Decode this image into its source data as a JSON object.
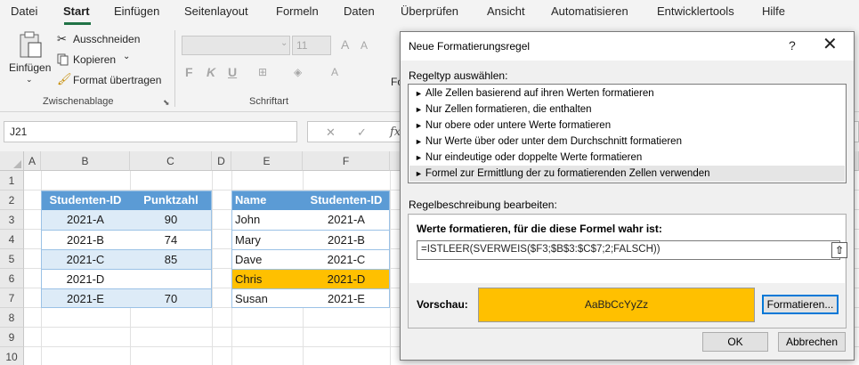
{
  "menu": {
    "items": [
      "Datei",
      "Start",
      "Einfügen",
      "Seitenlayout",
      "Formeln",
      "Daten",
      "Überprüfen",
      "Ansicht",
      "Automatisieren",
      "Entwicklertools",
      "Hilfe"
    ],
    "active": "Start"
  },
  "ribbon": {
    "clipboard": {
      "paste": "Einfügen",
      "cut": "Ausschneiden",
      "copy": "Kopieren",
      "format_painter": "Format übertragen",
      "group_label": "Zwischenablage"
    },
    "font": {
      "size": "11",
      "bold": "F",
      "italic": "K",
      "underline": "U",
      "group_label": "Schriftart"
    },
    "truncated_group": "Fo"
  },
  "formula_bar": {
    "name_box": "J21",
    "fx": "fx"
  },
  "grid": {
    "columns": [
      "A",
      "B",
      "C",
      "D",
      "E",
      "F"
    ],
    "rows": [
      "1",
      "2",
      "3",
      "4",
      "5",
      "6",
      "7",
      "8",
      "9",
      "10"
    ],
    "table1": {
      "headers": [
        "Studenten-ID",
        "Punktzahl"
      ],
      "rows": [
        [
          "2021-A",
          "90"
        ],
        [
          "2021-B",
          "74"
        ],
        [
          "2021-C",
          "85"
        ],
        [
          "2021-D",
          ""
        ],
        [
          "2021-E",
          "70"
        ]
      ]
    },
    "table2": {
      "headers": [
        "Name",
        "Studenten-ID"
      ],
      "rows": [
        [
          "John",
          "2021-A"
        ],
        [
          "Mary",
          "2021-B"
        ],
        [
          "Dave",
          "2021-C"
        ],
        [
          "Chris",
          "2021-D"
        ],
        [
          "Susan",
          "2021-E"
        ]
      ],
      "highlighted_row": 3,
      "highlight_color": "#ffc000"
    }
  },
  "dialog": {
    "title": "Neue Formatierungsregel",
    "help": "?",
    "close": "✕",
    "rule_type_label": "Regeltyp auswählen:",
    "rule_types": [
      "Alle Zellen basierend auf ihren Werten formatieren",
      "Nur Zellen formatieren, die enthalten",
      "Nur obere oder untere Werte formatieren",
      "Nur Werte über oder unter dem Durchschnitt formatieren",
      "Nur eindeutige oder doppelte Werte formatieren",
      "Formel zur Ermittlung der zu formatierenden Zellen verwenden"
    ],
    "selected_rule_index": 5,
    "description_label": "Regelbeschreibung bearbeiten:",
    "formula_label": "Werte formatieren, für die diese Formel wahr ist:",
    "formula": "=ISTLEER(SVERWEIS($F3;$B$3:$C$7;2;FALSCH))",
    "preview_label": "Vorschau:",
    "preview_text": "AaBbCcYyZz",
    "preview_color": "#ffc000",
    "format_button": "Formatieren...",
    "ok_button": "OK",
    "cancel_button": "Abbrechen"
  }
}
